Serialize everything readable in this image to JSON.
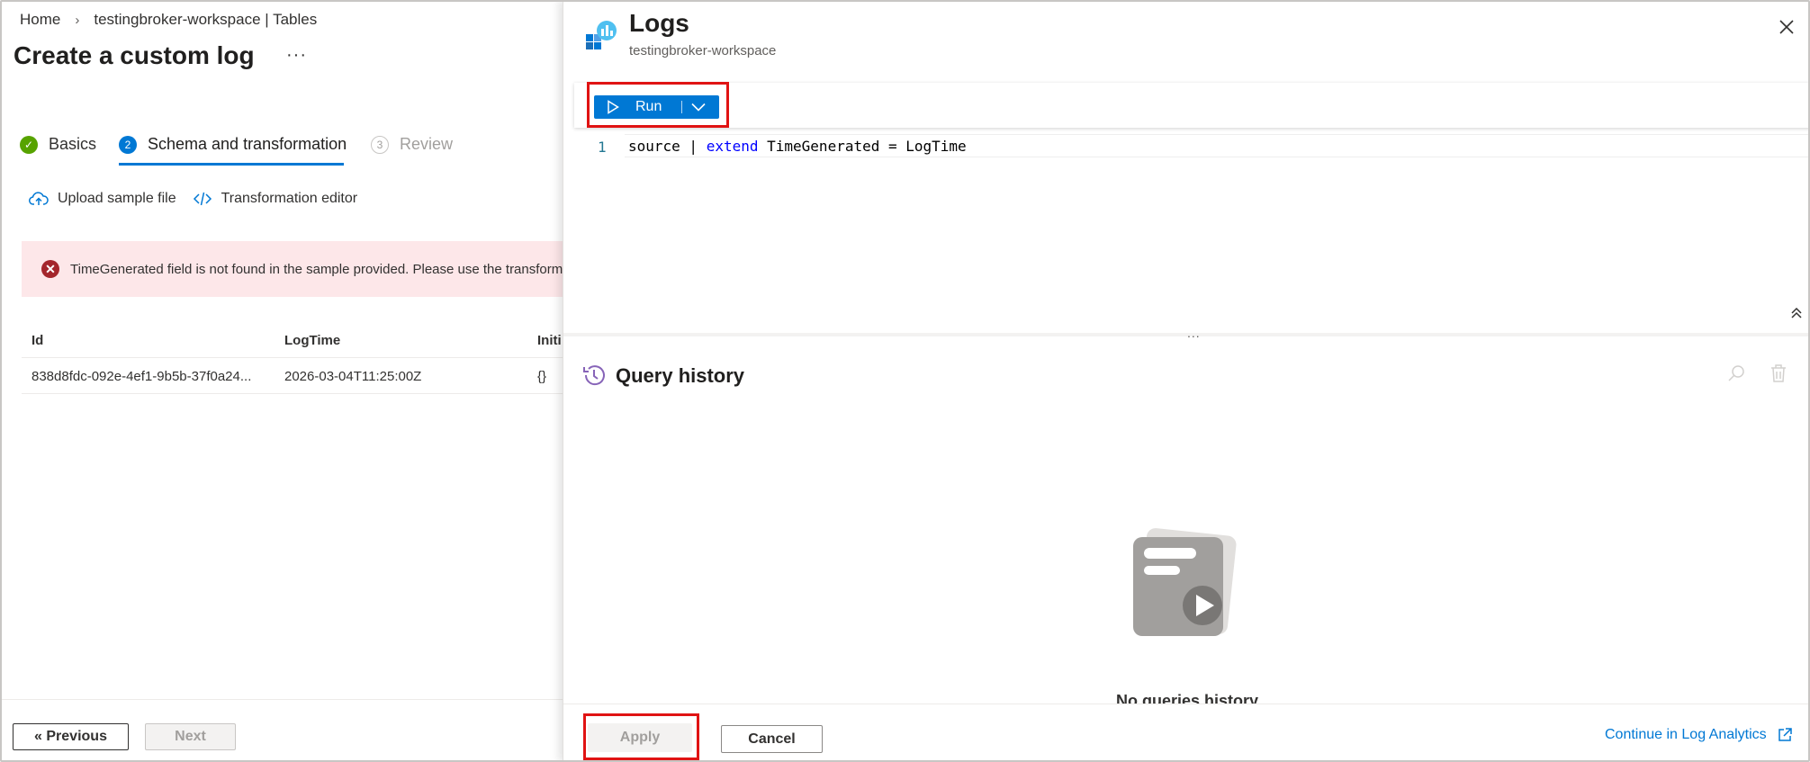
{
  "breadcrumb": {
    "home": "Home",
    "separator": "›",
    "workspace": "testingbroker-workspace | Tables"
  },
  "page": {
    "title": "Create a custom log",
    "more": "···"
  },
  "tabs": [
    {
      "label": "Basics",
      "badge": "✓"
    },
    {
      "label": "Schema and transformation",
      "badge": "2"
    },
    {
      "label": "Review",
      "badge": "3"
    }
  ],
  "commands": {
    "upload": "Upload sample file",
    "transformation": "Transformation editor"
  },
  "error": {
    "icon": "✕",
    "message": "TimeGenerated field is not found in the sample provided. Please use the transformation editor to populate the field."
  },
  "table": {
    "columns": [
      "Id",
      "LogTime",
      "Initi"
    ],
    "rows": [
      [
        "838d8fdc-092e-4ef1-9b5b-37f0a24...",
        "2026-03-04T11:25:00Z",
        "{}"
      ]
    ]
  },
  "wizard": {
    "previous": "« Previous",
    "next": "Next"
  },
  "logs": {
    "title": "Logs",
    "subtitle": "testingbroker-workspace",
    "run_label": "Run",
    "line_number": "1",
    "query": {
      "p1": "source | ",
      "keyword": "extend",
      "p2": " TimeGenerated = LogTime"
    },
    "splitter_dots": "...",
    "history_title": "Query history",
    "empty_text": "No queries history",
    "apply": "Apply",
    "cancel": "Cancel",
    "continue": "Continue in Log Analytics"
  },
  "colors": {
    "accent": "#0078d4",
    "success": "#57a300",
    "error": "#a4262c",
    "error_bg": "#fde7e9",
    "highlight": "#e01313"
  }
}
